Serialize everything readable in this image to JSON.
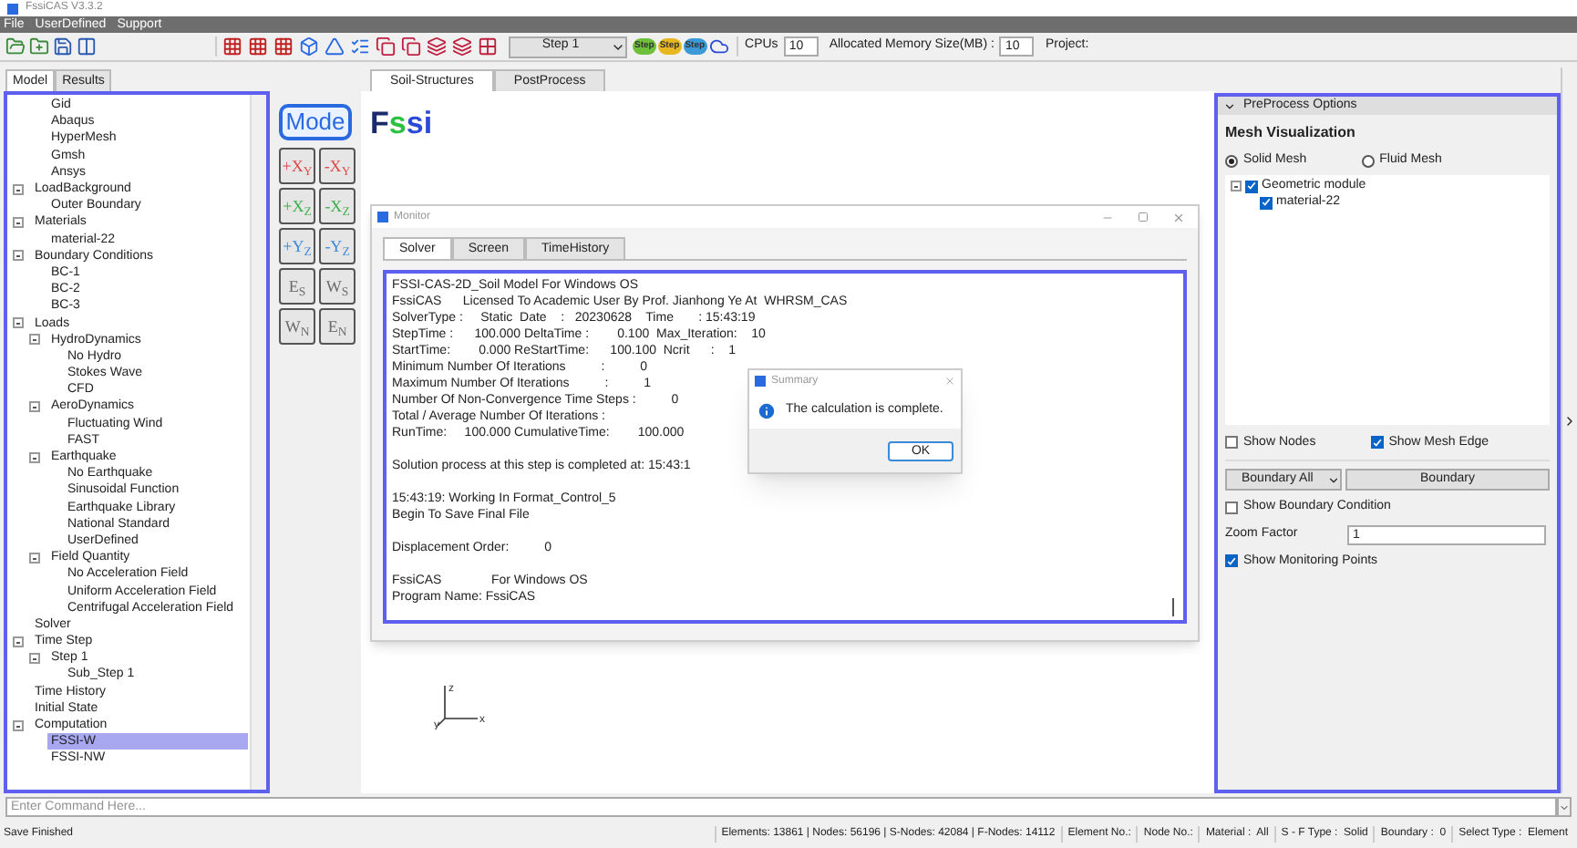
{
  "window": {
    "title": "FssiCAS V3.3.2"
  },
  "menu": [
    "File",
    "UserDefined",
    "Support"
  ],
  "toolbar": {
    "step_select": "Step 1",
    "step_buttons": [
      "Step",
      "Step",
      "Step"
    ],
    "cpus_label": "CPUs",
    "cpus": "10",
    "memory_label": "Allocated Memory Size(MB) :",
    "memory": "10",
    "project_label": "Project:"
  },
  "left_tabs": [
    {
      "label": "Model",
      "selected": true
    },
    {
      "label": "Results",
      "selected": false
    }
  ],
  "tree": {
    "continued_items": [
      {
        "label": "Gid",
        "selected": false
      },
      {
        "label": "Abaqus",
        "selected": false
      },
      {
        "label": "HyperMesh",
        "selected": false
      },
      {
        "label": "Gmsh",
        "selected": false
      },
      {
        "label": "Ansys",
        "selected": false
      }
    ],
    "items": [
      {
        "label": "LoadBackground",
        "selected": false,
        "children": [
          {
            "label": "Outer Boundary",
            "selected": false
          }
        ]
      },
      {
        "label": "Materials",
        "selected": false,
        "children": [
          {
            "label": "material-22",
            "selected": false
          }
        ]
      },
      {
        "label": "Boundary Conditions",
        "selected": false,
        "children": [
          {
            "label": "BC-1",
            "selected": false
          },
          {
            "label": "BC-2",
            "selected": false
          },
          {
            "label": "BC-3",
            "selected": false
          }
        ]
      },
      {
        "label": "Loads",
        "selected": false,
        "children": [
          {
            "label": "HydroDynamics",
            "selected": false,
            "children": [
              {
                "label": "No Hydro",
                "selected": false
              },
              {
                "label": "Stokes Wave",
                "selected": false
              },
              {
                "label": "CFD",
                "selected": false
              }
            ]
          },
          {
            "label": "AeroDynamics",
            "selected": false,
            "children": [
              {
                "label": "Fluctuating Wind",
                "selected": false
              },
              {
                "label": "FAST",
                "selected": false
              }
            ]
          },
          {
            "label": "Earthquake",
            "selected": false,
            "children": [
              {
                "label": "No Earthquake",
                "selected": false
              },
              {
                "label": "Sinusoidal Function",
                "selected": false
              },
              {
                "label": "Earthquake Library",
                "selected": false
              },
              {
                "label": "National Standard",
                "selected": false
              },
              {
                "label": "UserDefined",
                "selected": false
              }
            ]
          },
          {
            "label": "Field Quantity",
            "selected": false,
            "children": [
              {
                "label": "No Acceleration Field",
                "selected": false
              },
              {
                "label": "Uniform Acceleration Field",
                "selected": false
              },
              {
                "label": "Centrifugal Acceleration Field",
                "selected": false
              }
            ]
          }
        ]
      },
      {
        "label": "Solver",
        "selected": false
      },
      {
        "label": "Time Step",
        "selected": false,
        "children": [
          {
            "label": "Step 1",
            "selected": false,
            "children": [
              {
                "label": "Sub_Step 1",
                "selected": false
              }
            ]
          }
        ]
      },
      {
        "label": "Time History",
        "selected": false
      },
      {
        "label": "Initial State",
        "selected": false
      },
      {
        "label": "Computation",
        "selected": false,
        "children": [
          {
            "label": "FSSI-W",
            "selected": true
          },
          {
            "label": "FSSI-NW",
            "selected": false
          }
        ]
      }
    ]
  },
  "center_tabs": [
    {
      "label": "Soil-Structures",
      "selected": true
    },
    {
      "label": "PostProcess",
      "selected": false
    }
  ],
  "view_buttons": [
    {
      "label": "Mode",
      "color": "#2a6ae0"
    },
    {
      "label": "+X$_{Y}$",
      "color": "#e04848"
    },
    {
      "label": "-X$_{Y}$",
      "color": "#e04848"
    },
    {
      "label": "+X$_{Z}$",
      "color": "#3cb04a"
    },
    {
      "label": "-X$_{Z}$",
      "color": "#3cb04a"
    },
    {
      "label": "+Y$_{Z}$",
      "color": "#3a8ad8"
    },
    {
      "label": "-Y$_{Z}$",
      "color": "#3a8ad8"
    },
    {
      "label": "E$_{S}$",
      "color": "#6b6b6b"
    },
    {
      "label": "W$_{S}$",
      "color": "#6b6b6b"
    },
    {
      "label": "W$_{N}$",
      "color": "#6b6b6b"
    },
    {
      "label": "E$_{N}$",
      "color": "#6b6b6b"
    }
  ],
  "logo": "Fssi",
  "monitor": {
    "title": "Monitor",
    "tabs": [
      {
        "label": "Solver",
        "selected": true
      },
      {
        "label": "Screen",
        "selected": false
      },
      {
        "label": "TimeHistory",
        "selected": false
      }
    ],
    "blocks": [
      [
        "FSSI-CAS-2D_Soil Model For Windows OS",
        "FssiCAS      Licensed To Academic User By Prof. Jianhong Ye At  WHRSM_CAS",
        "SolverType :     Static  Date    :   20230628    Time       : 15:43:19",
        "StepTime :      100.000 DeltaTime :        0.100  Max_Iteration:    10",
        "StartTime:        0.000 ReStartTime:      100.100  Ncrit      :    1",
        "Minimum Number Of Iterations          :          0",
        "Maximum Number Of Iterations          :          1",
        "Number Of Non-Convergence Time Steps :          0",
        "Total / Average Number Of Iterations :",
        "RunTime:     100.000 CumulativeTime:        100.000"
      ],
      [
        "Solution process at this step is completed at: 15:43:1"
      ],
      [
        "15:43:19: Working In Format_Control_5",
        "Begin To Save Final File"
      ],
      [
        "Displacement Order:          0"
      ],
      [
        "FssiCAS              For Windows OS",
        "Program Name: FssiCAS"
      ]
    ]
  },
  "dialog": {
    "title": "Summary",
    "message": "The calculation is complete.",
    "button": "OK"
  },
  "axes": {
    "labels": [
      "z",
      "y",
      "x"
    ]
  },
  "preprocess": {
    "title": "PreProcess Options",
    "section": "Mesh Visualization",
    "mesh_modes": [
      {
        "label": "Solid Mesh",
        "selected": true
      },
      {
        "label": "Fluid Mesh",
        "selected": false
      }
    ],
    "mesh_tree": {
      "label": "Geometric module",
      "checked": true,
      "children": [
        {
          "label": "material-22",
          "checked": true
        }
      ]
    },
    "display_options": [
      {
        "label": "Show Nodes",
        "checked": false
      },
      {
        "label": "Show Mesh Edge",
        "checked": true
      }
    ],
    "boundary_all": "Boundary All",
    "boundary": "Boundary",
    "show_boundary_condition": {
      "label": "Show Boundary Condition",
      "checked": false
    },
    "zoom_label": "Zoom Factor",
    "zoom_value": "1",
    "show_monitoring_points": {
      "label": "Show Monitoring Points",
      "checked": true
    }
  },
  "command": {
    "placeholder": "Enter Command Here..."
  },
  "status_bar": {
    "message": "Save Finished",
    "fields": [
      "Elements: 13861 | Nodes: 56196 | S-Nodes: 42084 | F-Nodes: 14112",
      "Element No.:",
      "Node No.:",
      "Material :  All",
      "S - F Type :  Solid",
      "Boundary :  0",
      "Select Type :  Element"
    ]
  }
}
